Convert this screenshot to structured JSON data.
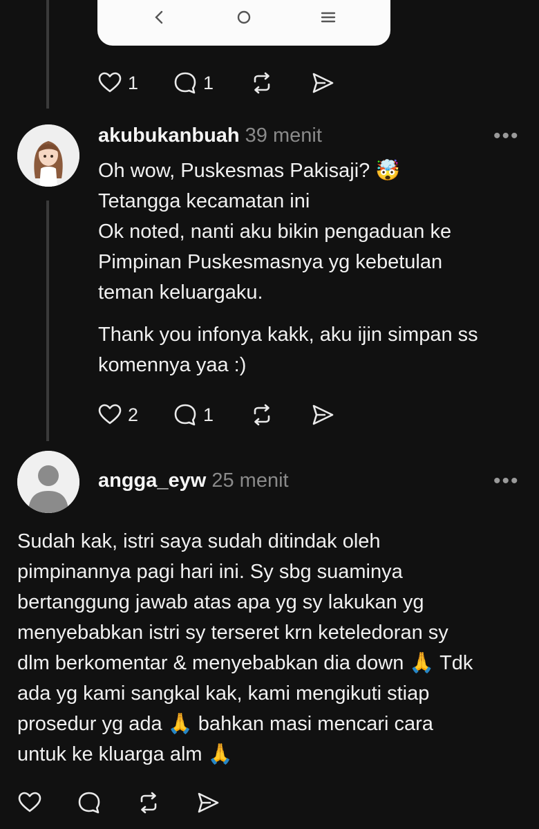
{
  "post1": {
    "actions": {
      "likes": "1",
      "replies": "1"
    }
  },
  "reply1": {
    "username": "akubukanbuah",
    "time": "39 menit",
    "more": "•••",
    "lines": [
      "Oh wow, Puskesmas Pakisaji? 🤯",
      "Tetangga kecamatan ini",
      "Ok noted, nanti aku bikin pengaduan ke",
      "Pimpinan Puskesmasnya yg kebetulan",
      "teman keluargaku."
    ],
    "lines2": [
      "Thank you infonya kakk, aku ijin simpan ss",
      "komennya yaa :)"
    ],
    "actions": {
      "likes": "2",
      "replies": "1"
    }
  },
  "reply2": {
    "username": "angga_eyw",
    "time": "25 menit",
    "more": "•••",
    "lines": [
      "Sudah kak, istri saya sudah ditindak oleh",
      "pimpinannya pagi hari ini. Sy sbg suaminya",
      "bertanggung jawab atas apa yg sy lakukan yg",
      "menyebabkan istri sy terseret krn keteledoran sy",
      "dlm berkomentar & menyebabkan dia down 🙏 Tdk",
      "ada yg kami sangkal kak, kami mengikuti stiap",
      "prosedur yg ada 🙏 bahkan masi mencari cara",
      "untuk ke kluarga alm 🙏"
    ]
  },
  "icons": {
    "like": "heart-icon",
    "reply": "comment-bubble-icon",
    "repost": "repost-icon",
    "share": "send-icon",
    "back": "chevron-left-icon",
    "home": "circle-home-icon",
    "menu": "menu-lines-icon"
  },
  "colors": {
    "background": "#111111",
    "text": "#f1f1f1",
    "muted": "#8a8a8a",
    "card": "#fbfbfb"
  }
}
